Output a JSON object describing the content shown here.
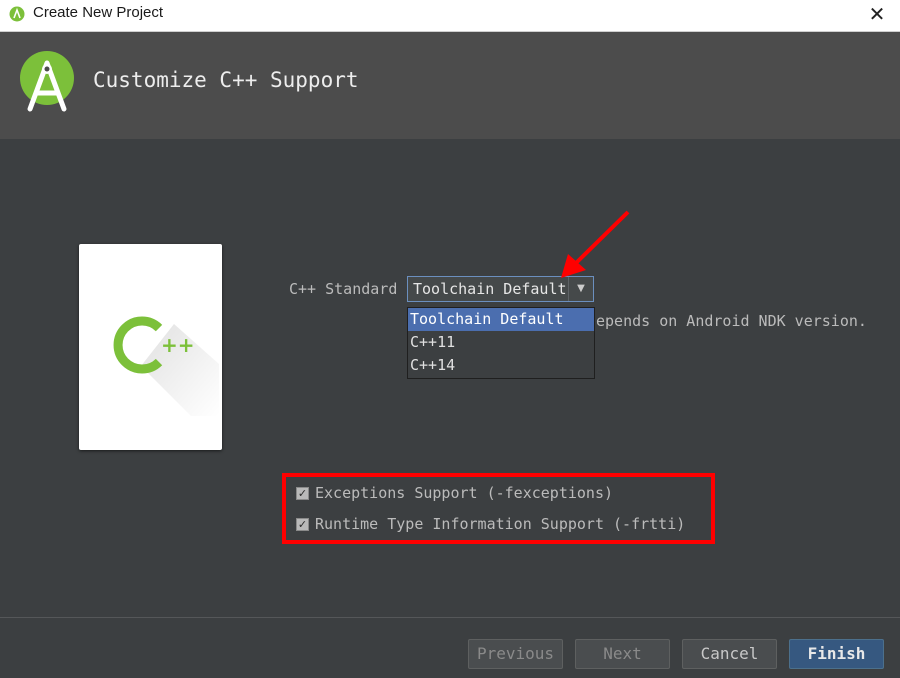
{
  "window": {
    "title": "Create New Project"
  },
  "header": {
    "heading": "Customize C++ Support"
  },
  "card": {
    "logo_letter": "C",
    "logo_plus": "++"
  },
  "cpp_standard": {
    "label": "C++ Standard",
    "selected": "Toolchain Default",
    "options": [
      "Toolchain Default",
      "C++11",
      "C++14"
    ],
    "hint_visible_fragment": "epends on Android NDK version."
  },
  "checkboxes": [
    {
      "label": "Exceptions Support (-fexceptions)",
      "checked": true
    },
    {
      "label": "Runtime Type Information Support (-frtti)",
      "checked": true
    }
  ],
  "buttons": {
    "previous": "Previous",
    "next": "Next",
    "cancel": "Cancel",
    "finish": "Finish"
  },
  "colors": {
    "android_green": "#7cc03a",
    "annotation_red": "#ff0000",
    "selection_blue": "#4b6eaf"
  }
}
